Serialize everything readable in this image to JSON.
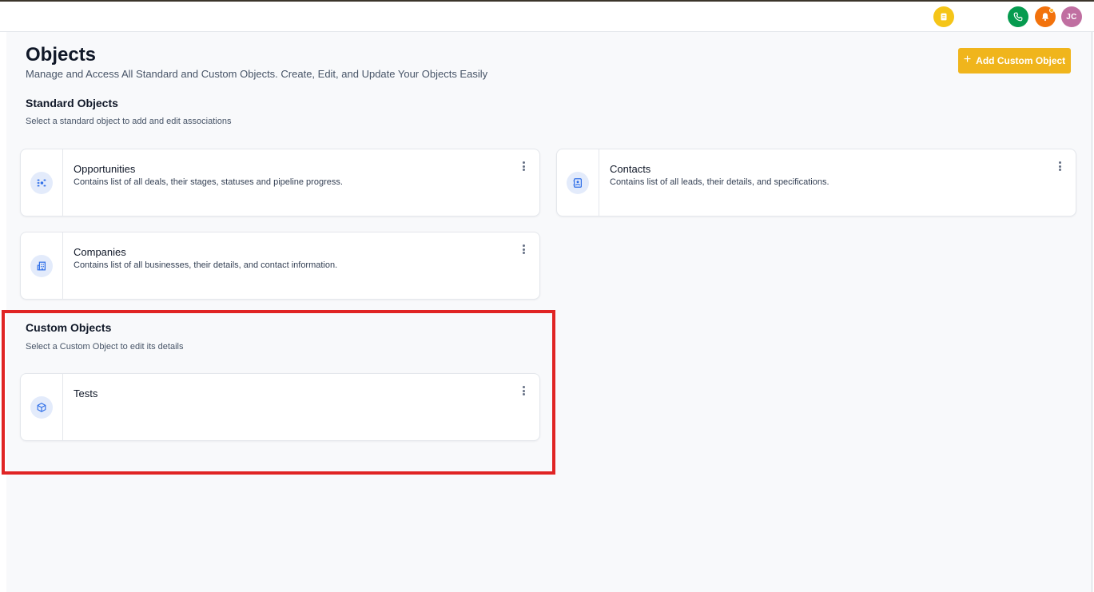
{
  "topbar": {
    "avatar_initials": "JC",
    "icons": {
      "quick": "notes-icon",
      "phone": "phone-icon",
      "bell": "bell-icon"
    },
    "colors": {
      "quick": "#f5c518",
      "phone": "#069b4f",
      "bell": "#f2720c",
      "avatar": "#c06fa1"
    }
  },
  "page": {
    "title": "Objects",
    "subtitle": "Manage and Access All Standard and Custom Objects. Create, Edit, and Update Your Objects Easily",
    "add_button_label": "Add Custom Object",
    "accent_color": "#f0b51c"
  },
  "standard": {
    "title": "Standard Objects",
    "subtitle": "Select a standard object to add and edit associations",
    "items": [
      {
        "title": "Opportunities",
        "description": "Contains list of all deals, their stages, statuses and pipeline progress.",
        "icon": "pipeline-icon"
      },
      {
        "title": "Contacts",
        "description": "Contains list of all leads, their details, and specifications.",
        "icon": "contact-book-icon"
      },
      {
        "title": "Companies",
        "description": "Contains list of all businesses, their details, and contact information.",
        "icon": "building-icon"
      }
    ]
  },
  "custom": {
    "title": "Custom Objects",
    "subtitle": "Select a Custom Object to edit its details",
    "items": [
      {
        "title": "Tests",
        "description": "",
        "icon": "cube-icon"
      }
    ]
  }
}
